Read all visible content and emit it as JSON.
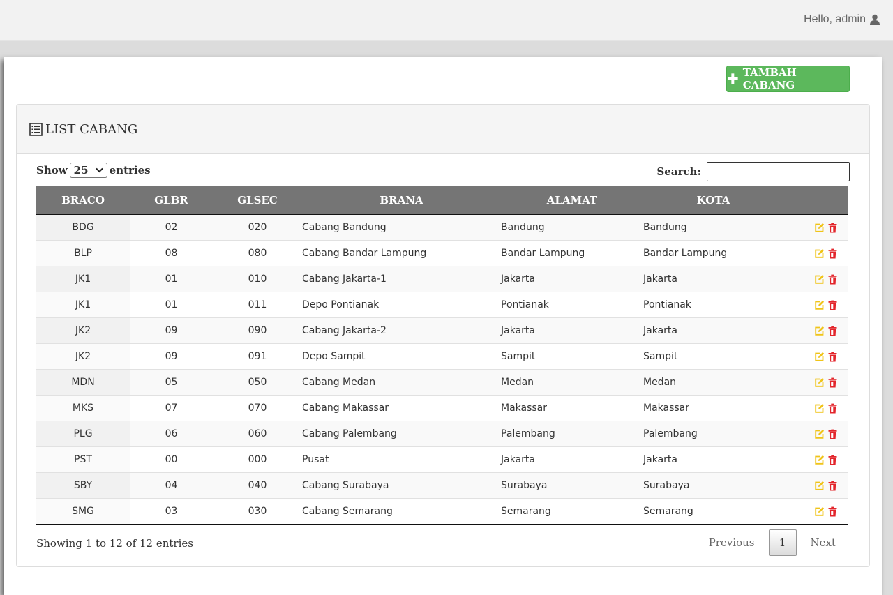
{
  "header": {
    "greeting": "Hello, admin",
    "user_icon": "user-icon"
  },
  "toolbar": {
    "add_label": "TAMBAH CABANG",
    "add_icon": "plus-icon",
    "accent_color": "#5cb85c"
  },
  "panel": {
    "title": "LIST CABANG",
    "title_icon": "list-icon"
  },
  "length": {
    "prefix": "Show",
    "value": "25",
    "suffix": "entries"
  },
  "search": {
    "label": "Search:",
    "value": ""
  },
  "table": {
    "columns": [
      "BRACO",
      "GLBR",
      "GLSEC",
      "BRANA",
      "ALAMAT",
      "KOTA",
      ""
    ],
    "rows": [
      [
        "BDG",
        "02",
        "020",
        "Cabang Bandung",
        "Bandung",
        "Bandung"
      ],
      [
        "BLP",
        "08",
        "080",
        "Cabang Bandar Lampung",
        "Bandar Lampung",
        "Bandar Lampung"
      ],
      [
        "JK1",
        "01",
        "010",
        "Cabang Jakarta-1",
        "Jakarta",
        "Jakarta"
      ],
      [
        "JK1",
        "01",
        "011",
        "Depo Pontianak",
        "Pontianak",
        "Pontianak"
      ],
      [
        "JK2",
        "09",
        "090",
        "Cabang Jakarta-2",
        "Jakarta",
        "Jakarta"
      ],
      [
        "JK2",
        "09",
        "091",
        "Depo Sampit",
        "Sampit",
        "Sampit"
      ],
      [
        "MDN",
        "05",
        "050",
        "Cabang Medan",
        "Medan",
        "Medan"
      ],
      [
        "MKS",
        "07",
        "070",
        "Cabang Makassar",
        "Makassar",
        "Makassar"
      ],
      [
        "PLG",
        "06",
        "060",
        "Cabang Palembang",
        "Palembang",
        "Palembang"
      ],
      [
        "PST",
        "00",
        "000",
        "Pusat",
        "Jakarta",
        "Jakarta"
      ],
      [
        "SBY",
        "04",
        "040",
        "Cabang Surabaya",
        "Surabaya",
        "Surabaya"
      ],
      [
        "SMG",
        "03",
        "030",
        "Cabang Semarang",
        "Semarang",
        "Semarang"
      ]
    ],
    "row_actions": [
      "edit-icon",
      "delete-icon"
    ],
    "edit_color": "#f0c419",
    "delete_color": "#e3262c"
  },
  "footer": {
    "info": "Showing 1 to 12 of 12 entries",
    "previous": "Previous",
    "current_page": "1",
    "next": "Next"
  }
}
